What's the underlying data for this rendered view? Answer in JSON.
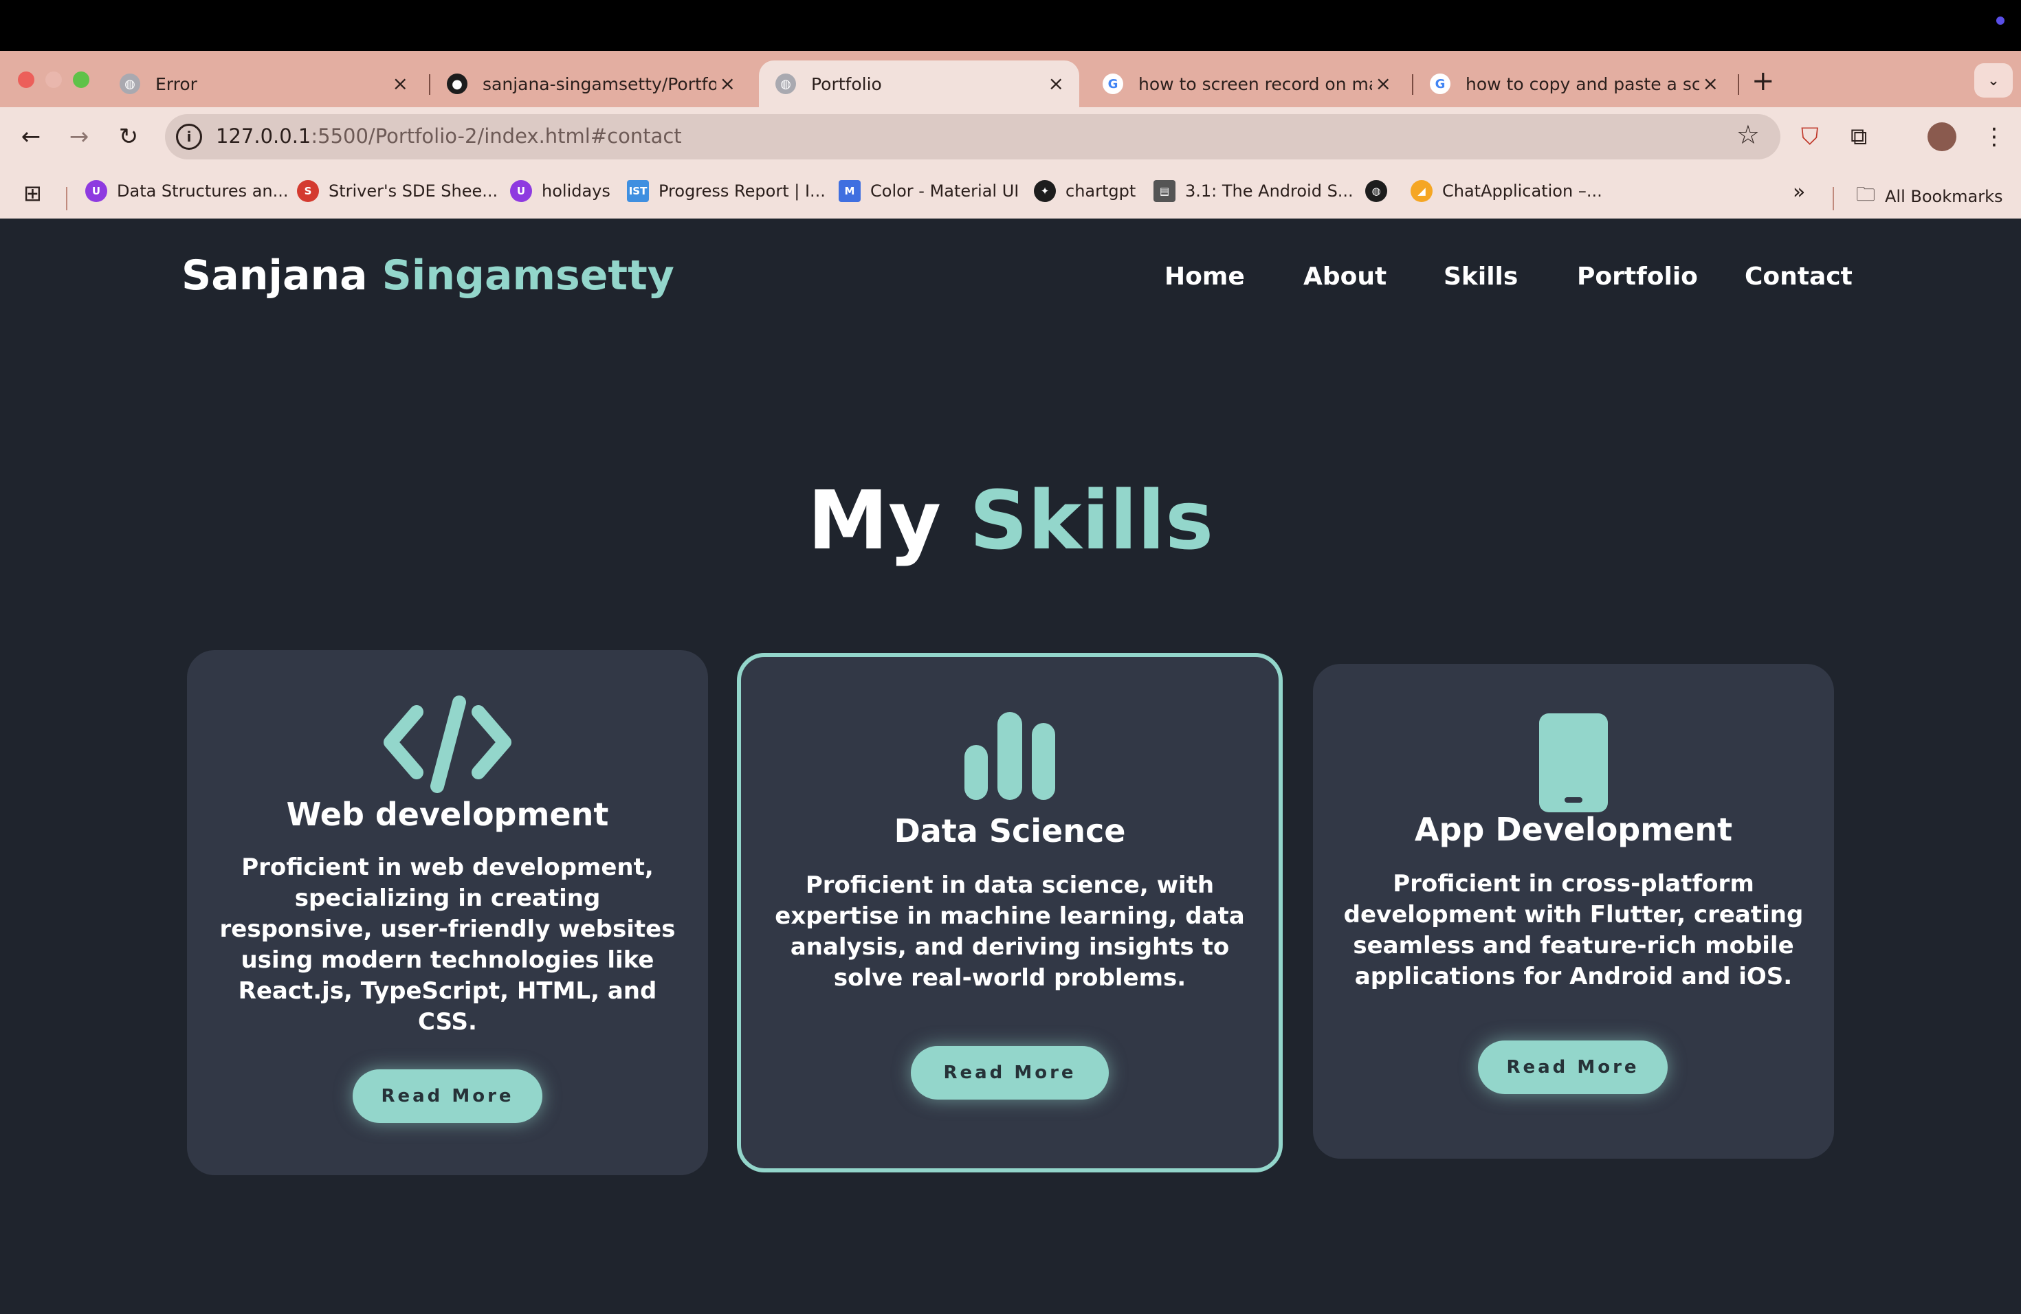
{
  "browser": {
    "tabs": [
      {
        "title": "Error",
        "favicon": "globe-icon"
      },
      {
        "title": "sanjana-singamsetty/Portfolio",
        "favicon": "github-icon"
      },
      {
        "title": "Portfolio",
        "favicon": "globe-icon",
        "active": true
      },
      {
        "title": "how to screen record on mac",
        "favicon": "google-icon"
      },
      {
        "title": "how to copy and paste a scre",
        "favicon": "google-icon"
      }
    ],
    "address": {
      "host": "127.0.0.1",
      "path": ":5500/Portfolio-2/index.html#contact"
    },
    "bookmarks": [
      {
        "label": "Data Structures an...",
        "icon_color": "#8e3ae0"
      },
      {
        "label": "Striver's SDE Shee...",
        "icon_color": "#d43a2f"
      },
      {
        "label": "holidays",
        "icon_color": "#8e3ae0"
      },
      {
        "label": "Progress Report | I...",
        "icon_color": "#3f8fe0"
      },
      {
        "label": "Color - Material UI",
        "icon_color": "#3f6fe0"
      },
      {
        "label": "chartgpt",
        "icon_color": "#1d1d1d"
      },
      {
        "label": "3.1: The Android S...",
        "icon_color": "#555555"
      },
      {
        "label": "ChatApplication –...",
        "icon_color": "#f5a623"
      }
    ],
    "all_bookmarks": "All Bookmarks",
    "overflow": "»"
  },
  "site": {
    "logo_first": "Sanjana ",
    "logo_second": "Singamsetty",
    "nav": [
      "Home",
      "About",
      "Skills",
      "Portfolio",
      "Contact"
    ]
  },
  "skills": {
    "title_first": "My ",
    "title_second": "Skills",
    "cards": [
      {
        "icon": "code-icon",
        "title": "Web development",
        "text": "Proficient in web development, specializing in creating responsive, user-friendly websites using modern technologies like React.js, TypeScript, HTML, and CSS.",
        "button": "Read More"
      },
      {
        "icon": "bar-chart-icon",
        "title": "Data Science",
        "text": "Proficient in data science, with expertise in machine learning, data analysis, and deriving insights to solve real-world problems.",
        "button": "Read More"
      },
      {
        "icon": "mobile-phone-icon",
        "title": "App Development",
        "text": "Proficient in cross-platform development with Flutter, creating seamless and feature-rich mobile applications for Android and iOS.",
        "button": "Read More"
      }
    ]
  },
  "colors": {
    "accent": "#93d6cb",
    "background": "#1f242d",
    "card": "#323846"
  }
}
